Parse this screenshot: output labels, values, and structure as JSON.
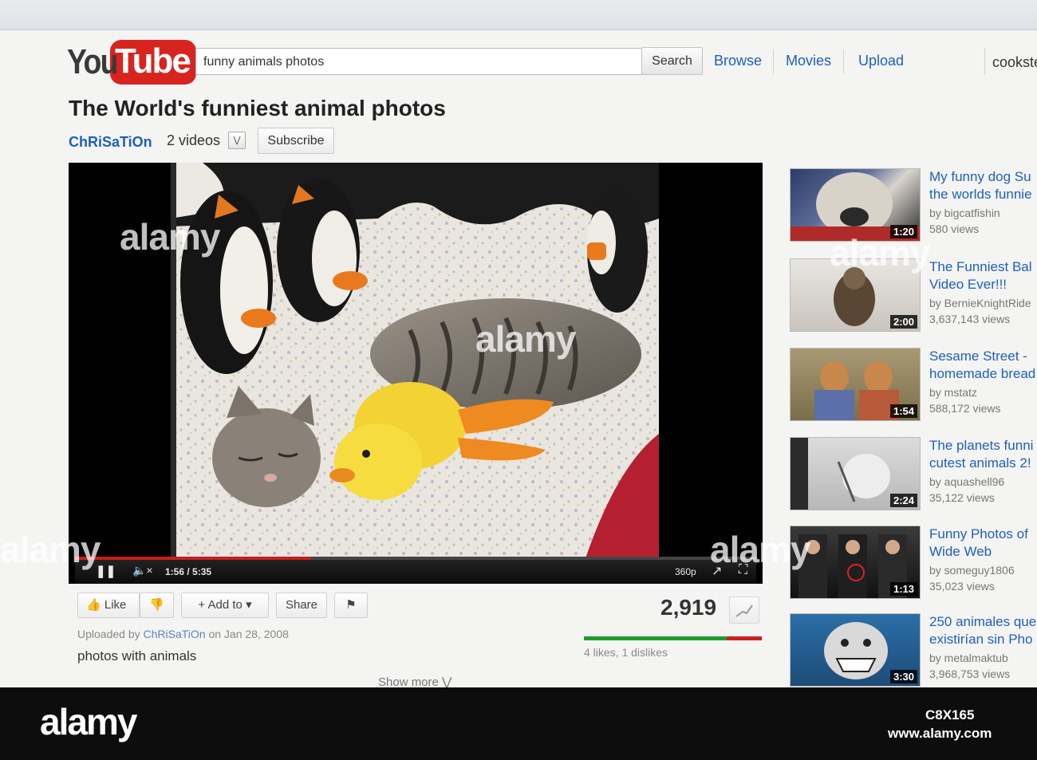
{
  "header": {
    "logo_you": "You",
    "logo_tube": "Tube",
    "search_value": "funny animals photos",
    "search_button": "Search",
    "nav": [
      "Browse",
      "Movies",
      "Upload"
    ],
    "user": "cookste"
  },
  "video": {
    "title": "The World's funniest animal photos",
    "channel": "ChRiSaTiOn",
    "video_count": "2 videos",
    "subscribe": "Subscribe",
    "time": "1:56 / 5:35",
    "quality": "360p",
    "progress_fraction": 0.347
  },
  "actions": {
    "like": "Like",
    "add_to": "Add to",
    "share": "Share",
    "views": "2,919"
  },
  "info": {
    "uploaded_prefix": "Uploaded by",
    "uploader": "ChRiSaTiOn",
    "uploaded_date": "on Jan 28, 2008",
    "description": "photos with animals",
    "show_more": "Show more",
    "likes_text": "4 likes, 1 dislikes"
  },
  "sidebar": [
    {
      "title1": "My funny dog Su",
      "title2": "the worlds funnie",
      "by": "by bigcatfishin",
      "views": "580 views",
      "duration": "1:20"
    },
    {
      "title1": "The Funniest Bal",
      "title2": "Video Ever!!!",
      "by": "by BernieKnightRide",
      "views": "3,637,143 views",
      "duration": "2:00"
    },
    {
      "title1": "Sesame Street -",
      "title2": "homemade bread",
      "by": "by mstatz",
      "views": "588,172 views",
      "duration": "1:54"
    },
    {
      "title1": "The planets funni",
      "title2": "cutest animals 2!",
      "by": "by aquashell96",
      "views": "35,122 views",
      "duration": "2:24"
    },
    {
      "title1": "Funny Photos of",
      "title2": "Wide Web",
      "by": "by someguy1806",
      "views": "35,023 views",
      "duration": "1:13"
    },
    {
      "title1": "250 animales que",
      "title2": "existirían sin Pho",
      "by": "by metalmaktub",
      "views": "3,968,753 views",
      "duration": "3:30"
    }
  ],
  "watermark": {
    "brand": "alamy",
    "image_id": "C8X165",
    "site": "www.alamy.com"
  }
}
